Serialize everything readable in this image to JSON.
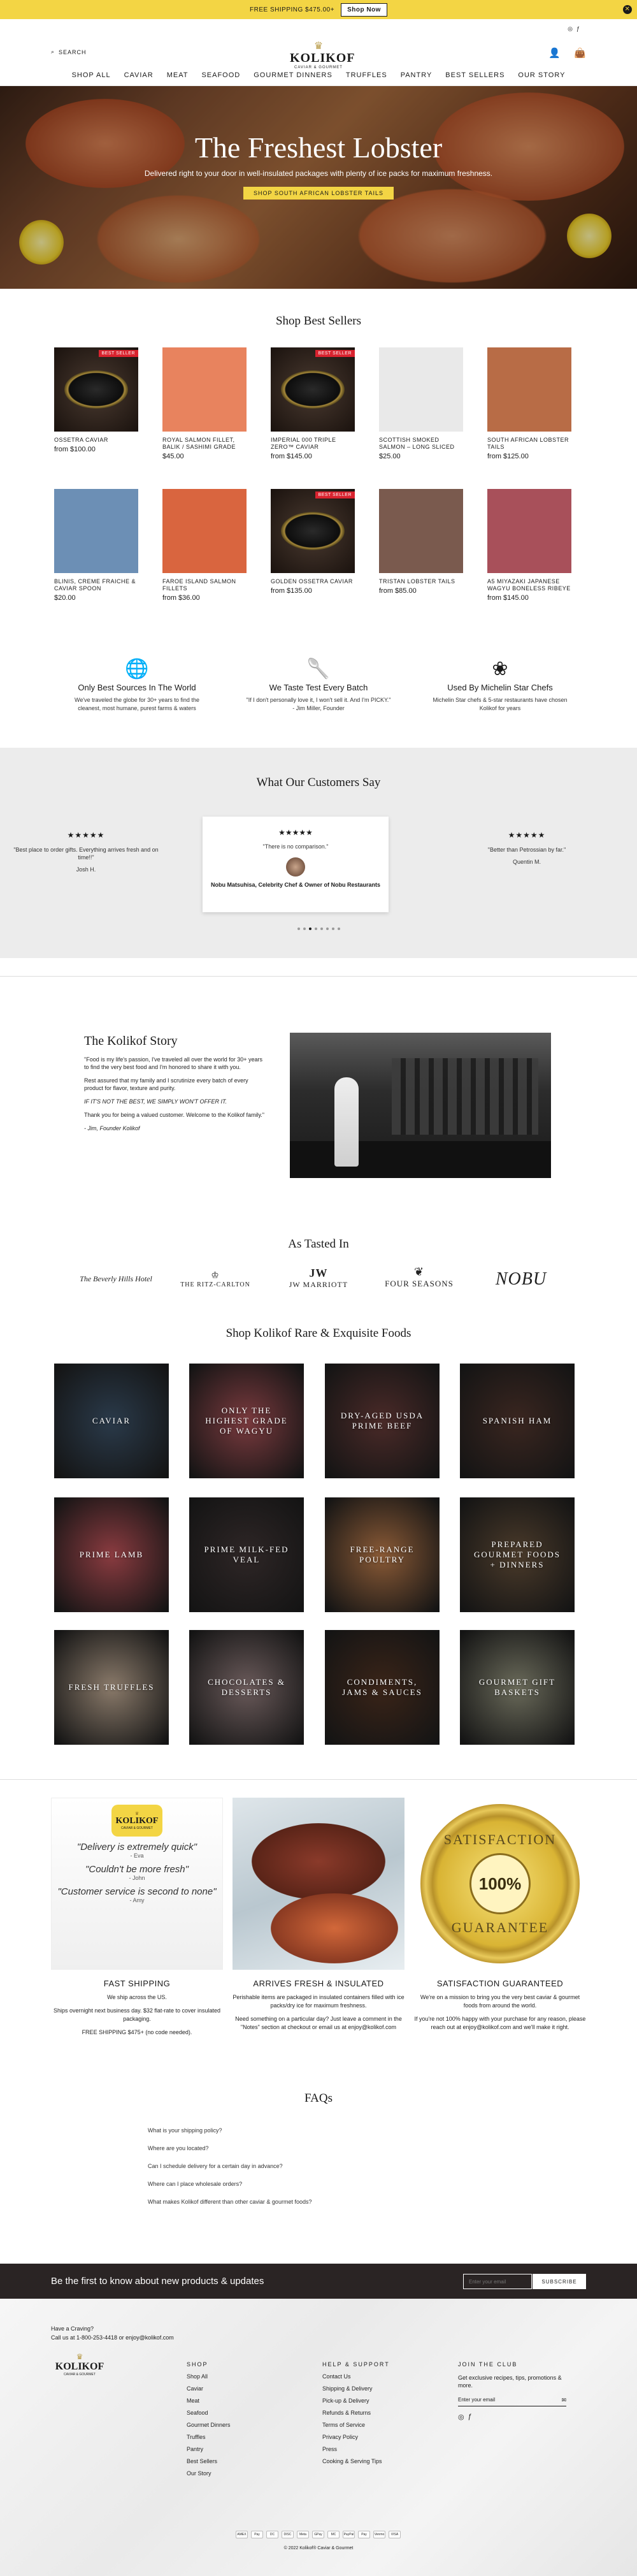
{
  "announcement": {
    "text": "FREE SHIPPING $475.00+",
    "cta": "Shop Now"
  },
  "header": {
    "search_label": "SEARCH",
    "logo_name": "KOLIKOF",
    "logo_sub": "CAVIAR & GOURMET",
    "nav": [
      "SHOP ALL",
      "CAVIAR",
      "MEAT",
      "SEAFOOD",
      "GOURMET DINNERS",
      "TRUFFLES",
      "PANTRY",
      "BEST SELLERS",
      "OUR STORY"
    ]
  },
  "hero": {
    "title": "The Freshest Lobster",
    "subtitle": "Delivered right to your door in well-insulated packages with plenty of ice packs for maximum freshness.",
    "cta": "SHOP SOUTH AFRICAN LOBSTER TAILS"
  },
  "best_sellers": {
    "title": "Shop Best Sellers",
    "badge": "BEST SELLER",
    "products": [
      {
        "name": "OSSETRA CAVIAR",
        "price": "from $100.00",
        "badge": true,
        "color": "#3a2a22"
      },
      {
        "name": "ROYAL SALMON FILLET, BALIK / SASHIMI GRADE",
        "price": "$45.00",
        "badge": false,
        "color": "#e8835e"
      },
      {
        "name": "IMPERIAL 000 TRIPLE ZERO™ CAVIAR",
        "price": "from $145.00",
        "badge": true,
        "color": "#3a2a22"
      },
      {
        "name": "SCOTTISH SMOKED SALMON – LONG SLICED",
        "price": "$25.00",
        "badge": false,
        "color": "#e9e9e9"
      },
      {
        "name": "SOUTH AFRICAN LOBSTER TAILS",
        "price": "from $125.00",
        "badge": false,
        "color": "#b86c46"
      },
      {
        "name": "BLINIS, CREME FRAICHE & CAVIAR SPOON",
        "price": "$20.00",
        "badge": false,
        "color": "#6c8fb5"
      },
      {
        "name": "FAROE ISLAND SALMON FILLETS",
        "price": "from $36.00",
        "badge": false,
        "color": "#d9653f"
      },
      {
        "name": "GOLDEN OSSETRA CAVIAR",
        "price": "from $135.00",
        "badge": true,
        "color": "#3a2a22"
      },
      {
        "name": "TRISTAN LOBSTER TAILS",
        "price": "from $85.00",
        "badge": false,
        "color": "#7a5a4e"
      },
      {
        "name": "A5 MIYAZAKI JAPANESE WAGYU BONELESS RIBEYE",
        "price": "from $145.00",
        "badge": false,
        "color": "#a8505a"
      }
    ]
  },
  "features": [
    {
      "title": "Only Best Sources In The World",
      "text": "We've traveled the globe for 30+ years to find the cleanest, most humane, purest farms & waters",
      "icon": "globe-icon"
    },
    {
      "title": "We Taste Test Every Batch",
      "text": "\"If I don't personally love it, I won't sell it. And I'm PICKY.\" - Jim Miller, Founder",
      "icon": "spoon-icon"
    },
    {
      "title": "Used By Michelin Star Chefs",
      "text": "Michelin Star chefs & 5-star restaurants have chosen Kolikof for years",
      "icon": "flower-icon"
    }
  ],
  "reviews": {
    "title": "What Our Customers Say",
    "stars": "★★★★★",
    "left": {
      "text": "\"Best place to order gifts. Everything arrives fresh and on time!!\"",
      "name": "Josh H."
    },
    "featured": {
      "text": "\"There is no comparison.\"",
      "name": "Nobu Matsuhisa, Celebrity Chef & Owner of Nobu Restaurants"
    },
    "right": {
      "text": "\"Better than Petrossian by far.\"",
      "name": "Quentin M."
    }
  },
  "story": {
    "title": "The Kolikof Story",
    "p1": "\"Food is my life's passion, I've traveled all over the world for 30+ years to find the very best food and I'm honored to share it with you.",
    "p2": "Rest assured that my family and I scrutinize every batch of every product for flavor, texture and purity.",
    "p3": "IF IT'S NOT THE BEST, WE SIMPLY WON'T OFFER IT.",
    "p4": "Thank you for being a valued customer. Welcome to the Kolikof family.\"",
    "sign": "- Jim, Founder Kolikof"
  },
  "tasted": {
    "title": "As Tasted In",
    "brands": [
      "The Beverly Hills Hotel",
      "THE RITZ-CARLTON",
      "JW MARRIOTT",
      "FOUR SEASONS",
      "NOBU"
    ]
  },
  "categories": {
    "title": "Shop Kolikof Rare & Exquisite Foods",
    "items": [
      {
        "label": "CAVIAR",
        "color": "#2a3a4a"
      },
      {
        "label": "ONLY THE HIGHEST GRADE OF WAGYU",
        "color": "#7a3a3e"
      },
      {
        "label": "DRY-AGED USDA PRIME BEEF",
        "color": "#4a2a28"
      },
      {
        "label": "SPANISH HAM",
        "color": "#3a2620"
      },
      {
        "label": "PRIME LAMB",
        "color": "#8a3b40"
      },
      {
        "label": "PRIME MILK-FED VEAL",
        "color": "#2e2626"
      },
      {
        "label": "FREE-RANGE POULTRY",
        "color": "#8a5a36"
      },
      {
        "label": "PREPARED GOURMET FOODS + DINNERS",
        "color": "#4a3a2a"
      },
      {
        "label": "FRESH TRUFFLES",
        "color": "#8a7a6a"
      },
      {
        "label": "CHOCOLATES & DESSERTS",
        "color": "#6a5a5a"
      },
      {
        "label": "CONDIMENTS, JAMS & SAUCES",
        "color": "#3a2418"
      },
      {
        "label": "GOURMET GIFT BASKETS",
        "color": "#6a6a5a"
      }
    ]
  },
  "guarantees": [
    {
      "title": "FAST SHIPPING",
      "lines": [
        "We ship across the US.",
        "Ships overnight next business day. $32 flat-rate to cover insulated packaging.",
        "FREE SHIPPING $475+ (no code needed)."
      ]
    },
    {
      "title": "ARRIVES FRESH & INSULATED",
      "lines": [
        "Perishable items are packaged in insulated containers filled with ice packs/dry ice for maximum freshness.",
        "Need something on a particular day? Just leave a comment in the \"Notes\" section at checkout or email us at enjoy@kolikof.com"
      ]
    },
    {
      "title": "SATISFACTION GUARANTEED",
      "lines": [
        "We're on a mission to bring you the very best caviar & gourmet foods from around the world.",
        "If you're not 100% happy with your purchase for any reason, please reach out at enjoy@kolikof.com and we'll make it right."
      ]
    }
  ],
  "ship_quotes": [
    {
      "q": "\"Delivery is extremely quick\"",
      "n": "- Eva"
    },
    {
      "q": "\"Couldn't be more fresh\"",
      "n": "- John"
    },
    {
      "q": "\"Customer service is second to none\"",
      "n": "- Amy"
    }
  ],
  "seal": {
    "top": "SATISFACTION",
    "mid": "100%",
    "bottom": "GUARANTEE"
  },
  "faq": {
    "title": "FAQs",
    "items": [
      "What is your shipping policy?",
      "Where are you located?",
      "Can I schedule delivery for a certain day in advance?",
      "Where can I place wholesale orders?",
      "What makes Kolikof different than other caviar & gourmet foods?"
    ]
  },
  "newsletter": {
    "title": "Be the first to know about new products & updates",
    "placeholder": "Enter your email",
    "button": "SUBSCRIBE"
  },
  "footer": {
    "craving": "Have a Craving?",
    "contact": "Call us at 1-800-253-4418 or enjoy@kolikof.com",
    "shop_heading": "SHOP",
    "shop": [
      "Shop All",
      "Caviar",
      "Meat",
      "Seafood",
      "Gourmet Dinners",
      "Truffles",
      "Pantry",
      "Best Sellers",
      "Our Story"
    ],
    "help_heading": "HELP & SUPPORT",
    "help": [
      "Contact Us",
      "Shipping & Delivery",
      "Pick-up & Delivery",
      "Refunds & Returns",
      "Terms of Service",
      "Privacy Policy",
      "Press",
      "Cooking & Serving Tips"
    ],
    "club_heading": "JOIN THE CLUB",
    "club_text": "Get exclusive recipes, tips, promotions & more.",
    "club_placeholder": "Enter your email",
    "payments": [
      "AMEX",
      "Pay",
      "DC",
      "DISC",
      "Meta",
      "GPay",
      "MC",
      "PayPal",
      "Pay",
      "Venmo",
      "VISA"
    ],
    "copyright": "© 2022 Kolikof® Caviar & Gourmet"
  }
}
